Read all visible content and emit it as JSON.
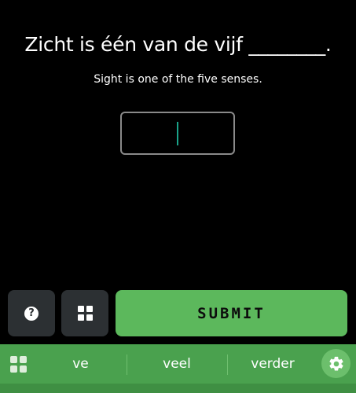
{
  "prompt": {
    "sentence": "Zicht is één van de vijf ________."
  },
  "translation": {
    "text": "Sight is one of the five senses."
  },
  "answer": {
    "value": "",
    "caret_color": "#1aa389"
  },
  "actions": {
    "help_icon": "question-circle-icon",
    "help_glyph": "?",
    "grid_icon": "grid-icon",
    "submit_label": "SUBMIT",
    "submit_color": "#5cb85c"
  },
  "suggestions": {
    "bar_color": "#4aa14e",
    "items": [
      "ve",
      "veel",
      "verder"
    ],
    "left_icon": "apps-grid-icon",
    "right_icon": "gear-icon"
  }
}
